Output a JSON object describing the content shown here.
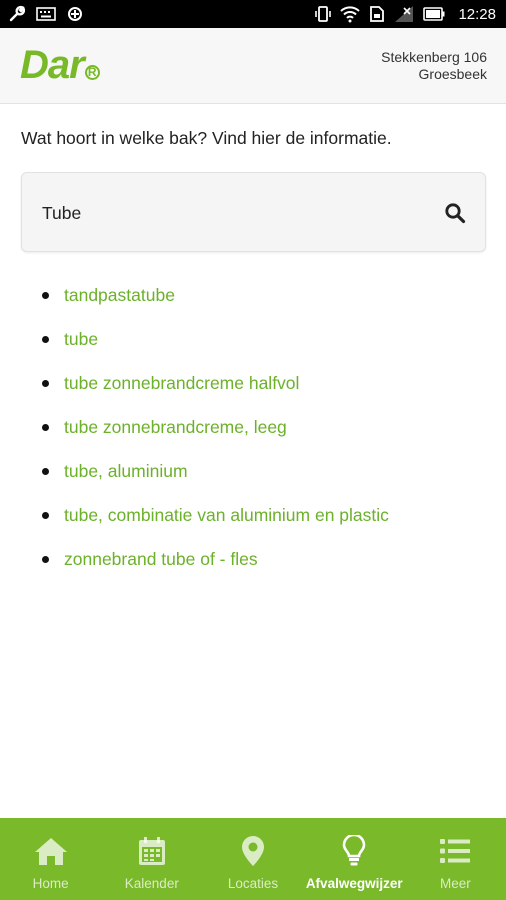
{
  "status_bar": {
    "time": "12:28",
    "icons": [
      "wrench-icon",
      "keyboard-icon",
      "sync-icon",
      "vibrate-icon",
      "wifi-icon",
      "sim-icon",
      "signal-icon",
      "battery-icon"
    ]
  },
  "header": {
    "logo": "Dar",
    "address_line1": "Stekkenberg 106",
    "address_line2": "Groesbeek"
  },
  "main": {
    "intro": "Wat hoort in welke bak? Vind hier de informatie.",
    "search": {
      "value": "Tube",
      "icon": "search-icon"
    },
    "results": [
      "tandpastatube",
      "tube",
      "tube zonnebrandcreme halfvol",
      "tube zonnebrandcreme, leeg",
      "tube, aluminium",
      "tube, combinatie van aluminium en plastic",
      "zonnebrand tube of - fles"
    ]
  },
  "bottom_nav": {
    "items": [
      {
        "label": "Home",
        "icon": "home-icon",
        "active": false
      },
      {
        "label": "Kalender",
        "icon": "calendar-icon",
        "active": false
      },
      {
        "label": "Locaties",
        "icon": "map-pin-icon",
        "active": false
      },
      {
        "label": "Afvalwegwijzer",
        "icon": "lightbulb-icon",
        "active": true
      },
      {
        "label": "Meer",
        "icon": "list-icon",
        "active": false
      }
    ]
  },
  "colors": {
    "accent": "#7ab92a",
    "link": "#6cb12a",
    "status_bar": "#000000"
  }
}
